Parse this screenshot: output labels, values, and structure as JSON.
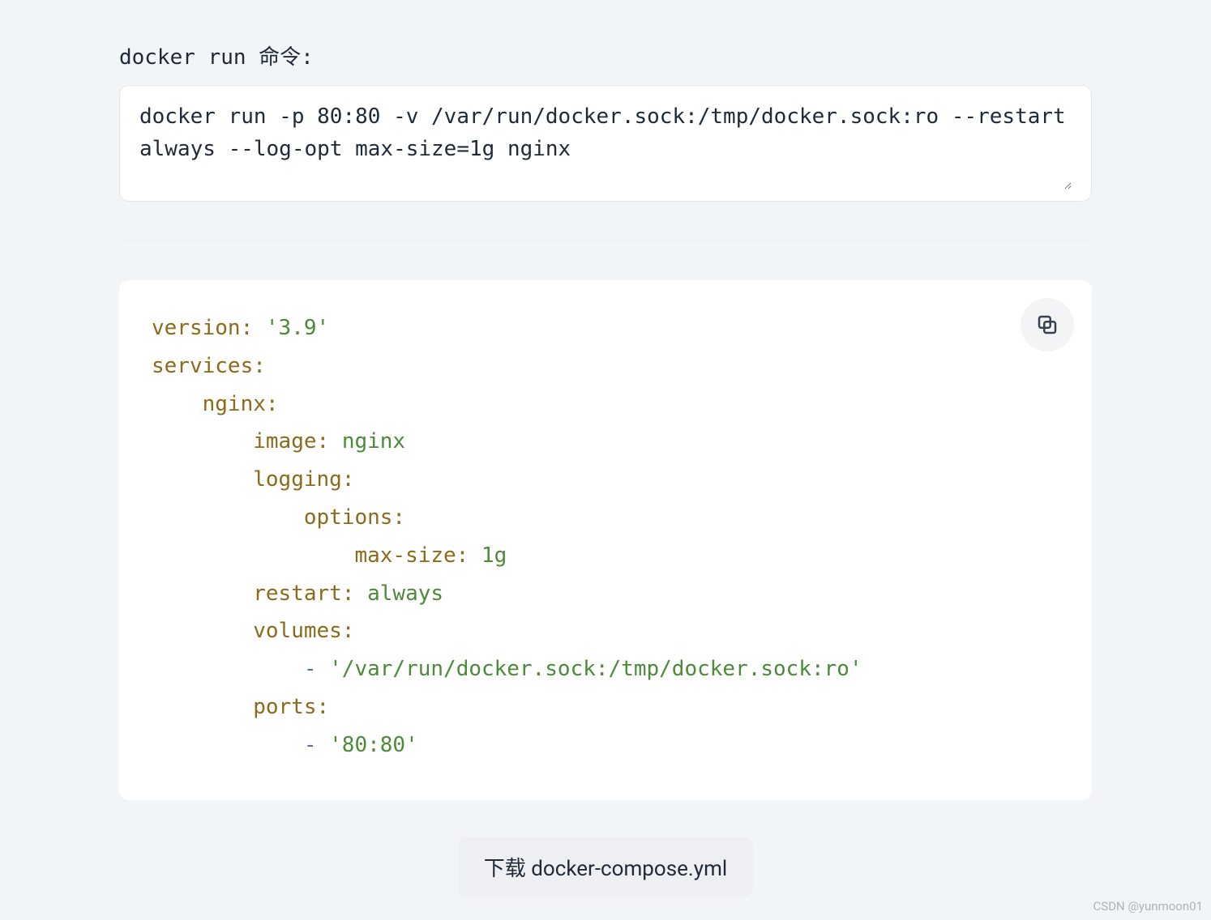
{
  "input": {
    "label": "docker run 命令:",
    "command": "docker run -p 80:80 -v /var/run/docker.sock:/tmp/docker.sock:ro --restart always --log-opt max-size=1g nginx"
  },
  "yaml": {
    "version_key": "version:",
    "version_val": "'3.9'",
    "services_key": "services:",
    "nginx_key": "nginx:",
    "image_key": "image:",
    "image_val": "nginx",
    "logging_key": "logging:",
    "options_key": "options:",
    "maxsize_key": "max-size:",
    "maxsize_val": "1g",
    "restart_key": "restart:",
    "restart_val": "always",
    "volumes_key": "volumes:",
    "volumes_item": "'/var/run/docker.sock:/tmp/docker.sock:ro'",
    "ports_key": "ports:",
    "ports_item": "'80:80'",
    "dash": "-"
  },
  "buttons": {
    "download": "下载 docker-compose.yml"
  },
  "watermark": "CSDN @yunmoon01"
}
